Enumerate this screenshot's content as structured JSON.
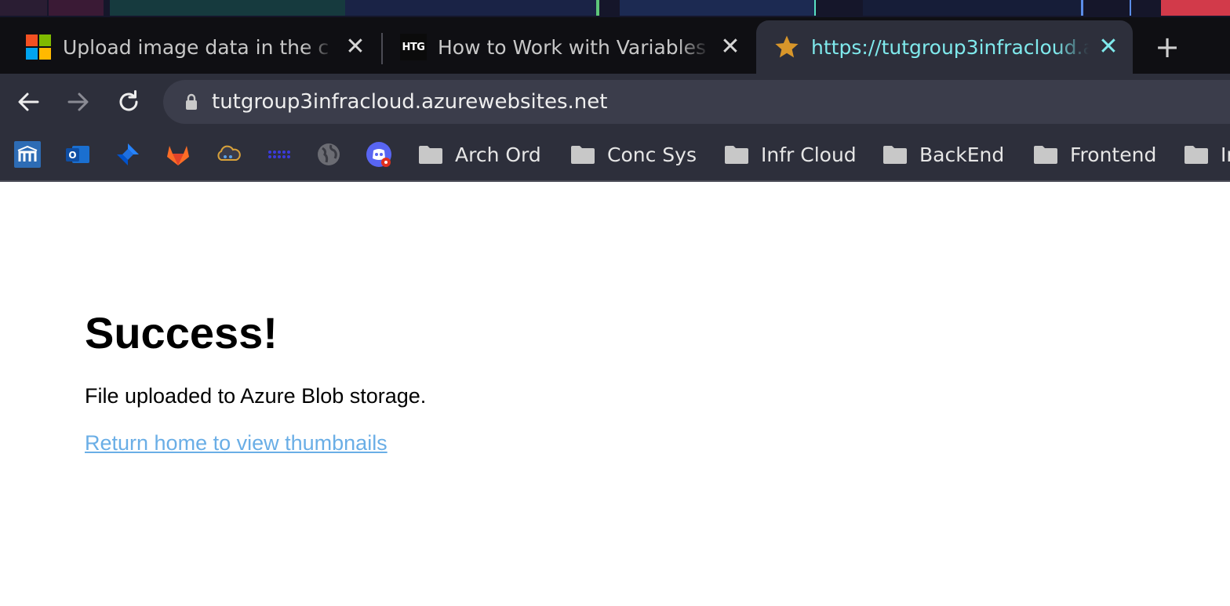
{
  "browser": {
    "tabs": [
      {
        "favicon": "microsoft-logo-icon",
        "title": "Upload image data in the c",
        "active": false
      },
      {
        "favicon": "htg-logo-icon",
        "favicon_text": "HTG",
        "title": "How to Work with Variables I",
        "active": false
      },
      {
        "favicon": "star-icon",
        "title": "https://tutgroup3infracloud.a",
        "active": true
      }
    ],
    "new_tab_label": "+",
    "close_glyph": "✕",
    "url": "tutgroup3infracloud.azurewebsites.net",
    "bookmarks": {
      "icons": [
        "moodle-icon",
        "outlook-icon",
        "jira-icon",
        "gitlab-icon",
        "cloud-icon",
        "dots-app-icon",
        "globe-icon",
        "chat-app-icon"
      ],
      "folders": [
        {
          "label": "Arch Ord"
        },
        {
          "label": "Conc Sys"
        },
        {
          "label": "Infr Cloud"
        },
        {
          "label": "BackEnd"
        },
        {
          "label": "Frontend"
        },
        {
          "label": "Ir"
        }
      ]
    },
    "colors": {
      "tab_strip": "#0f0f13",
      "toolbar": "#2d2f3b",
      "active_tab_text": "#7fe9ec"
    }
  },
  "page": {
    "heading": "Success!",
    "message": "File uploaded to Azure Blob storage.",
    "link_text": "Return home to view thumbnails",
    "link_color": "#6aaee6"
  }
}
